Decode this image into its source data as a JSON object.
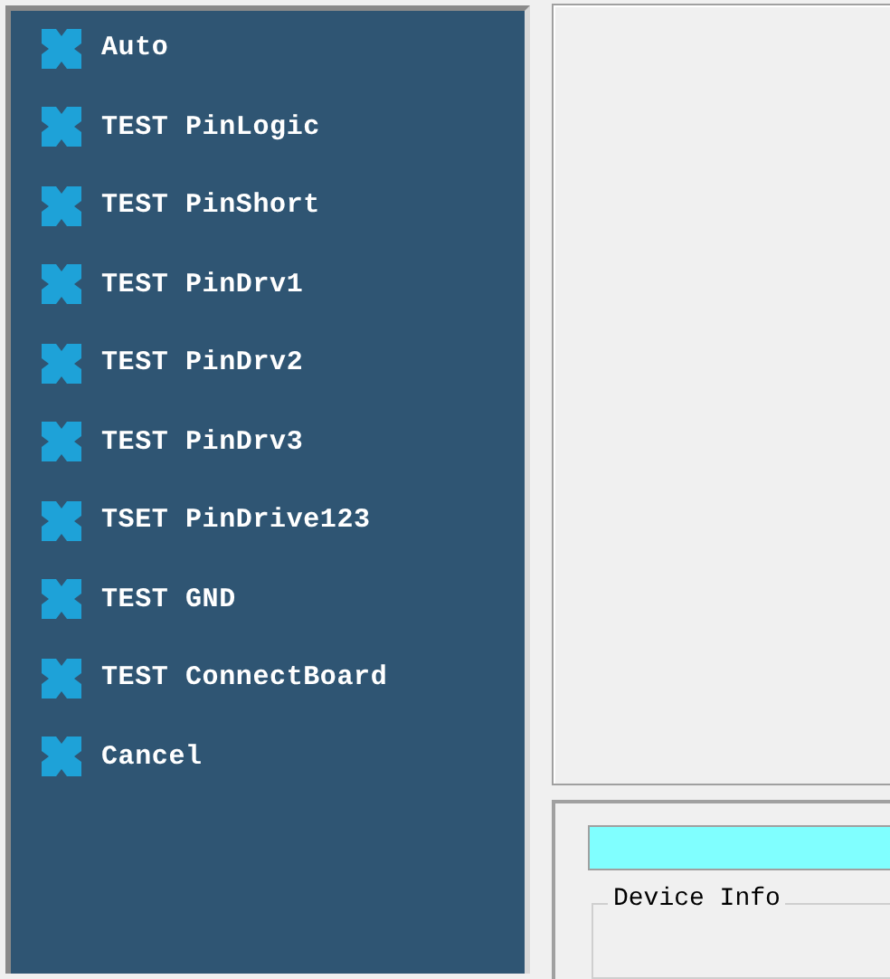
{
  "menu": {
    "items": [
      {
        "label": "Auto"
      },
      {
        "label": "TEST PinLogic"
      },
      {
        "label": "TEST PinShort"
      },
      {
        "label": "TEST PinDrv1"
      },
      {
        "label": "TEST PinDrv2"
      },
      {
        "label": "TEST PinDrv3"
      },
      {
        "label": "TSET PinDrive123"
      },
      {
        "label": "TEST GND"
      },
      {
        "label": "TEST ConnectBoard"
      },
      {
        "label": "Cancel"
      }
    ]
  },
  "device_info": {
    "title": "Device Info"
  }
}
